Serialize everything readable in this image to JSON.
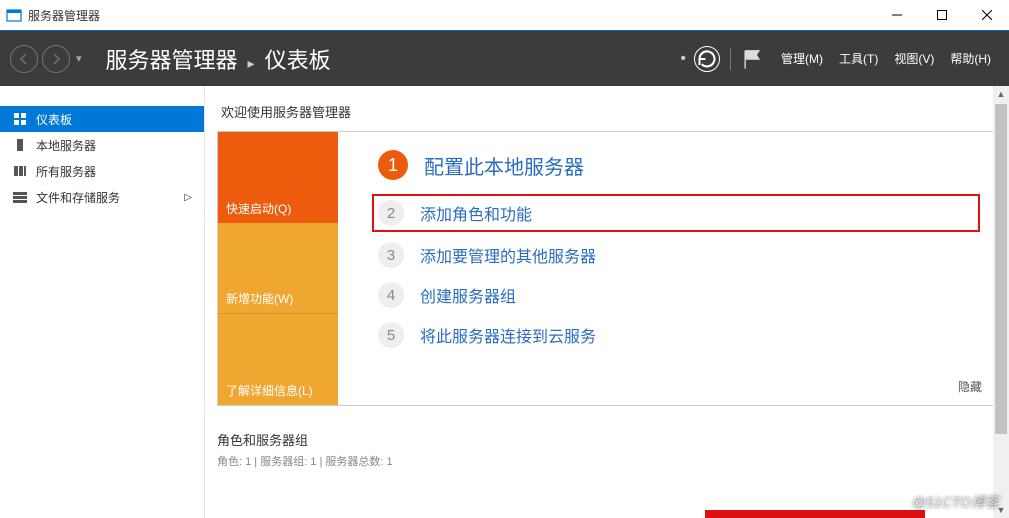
{
  "window": {
    "title": "服务器管理器"
  },
  "header": {
    "breadcrumb1": "服务器管理器",
    "breadcrumb_sep": "▸",
    "breadcrumb2": "仪表板",
    "menus": {
      "manage": "管理(M)",
      "tools": "工具(T)",
      "view": "视图(V)",
      "help": "帮助(H)"
    }
  },
  "sidebar": {
    "items": [
      {
        "label": "仪表板",
        "icon": "dashboard-icon"
      },
      {
        "label": "本地服务器",
        "icon": "localserver-icon"
      },
      {
        "label": "所有服务器",
        "icon": "allservers-icon"
      },
      {
        "label": "文件和存储服务",
        "icon": "storage-icon",
        "submenu": true
      }
    ]
  },
  "main": {
    "welcome_title": "欢迎使用服务器管理器",
    "tiles": {
      "quickstart": "快速启动(Q)",
      "whatsnew": "新增功能(W)",
      "learnmore": "了解详细信息(L)"
    },
    "tasks": [
      {
        "num": "1",
        "label": "配置此本地服务器"
      },
      {
        "num": "2",
        "label": "添加角色和功能"
      },
      {
        "num": "3",
        "label": "添加要管理的其他服务器"
      },
      {
        "num": "4",
        "label": "创建服务器组"
      },
      {
        "num": "5",
        "label": "将此服务器连接到云服务"
      }
    ],
    "hide_label": "隐藏",
    "groups": {
      "title": "角色和服务器组",
      "subtitle": "角色: 1 | 服务器组: 1 | 服务器总数: 1"
    }
  },
  "watermark": "@51CTO博客"
}
